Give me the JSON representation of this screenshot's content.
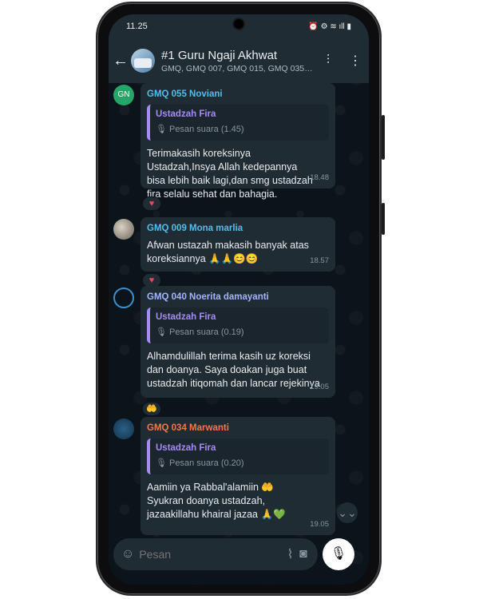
{
  "status": {
    "time": "11.25",
    "icons": "⏰ ⚙ ≋ ıll ▮"
  },
  "header": {
    "back": "←",
    "title": "#1 Guru Ngaji Akhwat",
    "subtitle": "GMQ, GMQ 007, GMQ 015, GMQ 035, ...",
    "voice_icon": "⫶",
    "menu_icon": "⋮"
  },
  "messages": [
    {
      "avatar_text": "GN",
      "sender": "GMQ 055 Noviani",
      "sender_color": "#53bdeb",
      "quote_name": "Ustadzah Fira",
      "quote_text": "🎙 Pesan suara (1.45)",
      "text": "Terimakasih koreksinya Ustadzah,Insya Allah kedepannya bisa lebih baik lagi,dan smg ustadzah fira selalu sehat dan bahagia.",
      "time": "18.48",
      "reaction": "♥"
    },
    {
      "sender": "GMQ 009 Mona marlia",
      "sender_color": "#53bdeb",
      "text": "Afwan ustazah makasih banyak atas koreksiannya 🙏🙏😊😊",
      "time": "18.57",
      "reaction": "♥"
    },
    {
      "sender": "GMQ 040 Noerita damayanti",
      "sender_color": "#a5b4fc",
      "quote_name": "Ustadzah Fira",
      "quote_text": "🎙 Pesan suara (0.19)",
      "text": "Alhamdulillah terima kasih uz koreksi dan doanya. Saya doakan juga buat ustadzah itiqomah dan lancar rejekinya",
      "time": "19.05",
      "reaction": "🤲"
    },
    {
      "sender": "GMQ 034 Marwanti",
      "sender_color": "#fb7448",
      "quote_name": "Ustadzah Fira",
      "quote_text": "🎙 Pesan suara (0.20)",
      "text_line1": "Aamiin ya Rabbal'alamiin 🤲",
      "text_line2": "Syukran doanya ustadzah,",
      "text_line3": "jazaakillahu khairal jazaa 🙏💚",
      "time": "19.05"
    }
  ],
  "scroll_icon": "⌄⌄",
  "input": {
    "emoji_icon": "☺",
    "placeholder": "Pesan",
    "attach_icon": "⌇",
    "camera_icon": "◙",
    "mic_icon": "🎙"
  }
}
